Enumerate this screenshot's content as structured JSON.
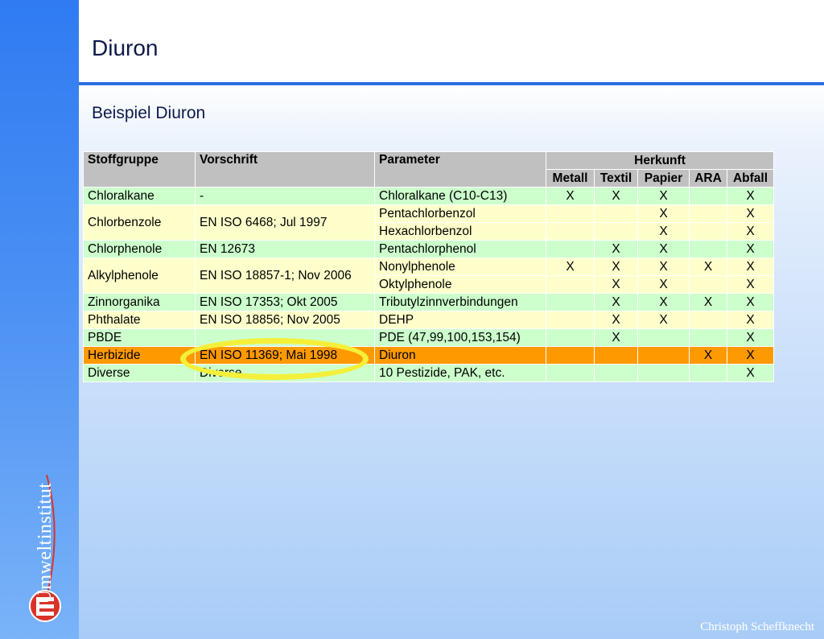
{
  "slide": {
    "title": "Diuron",
    "subtitle": "Beispiel Diuron",
    "footer": "Christoph Scheffknecht",
    "logo_text": "Umweltinstitut"
  },
  "table": {
    "headers": {
      "stoffgruppe": "Stoffgruppe",
      "vorschrift": "Vorschrift",
      "parameter": "Parameter",
      "herkunft": "Herkunft",
      "metall": "Metall",
      "textil": "Textil",
      "papier": "Papier",
      "ara": "ARA",
      "abfall": "Abfall"
    },
    "rows": [
      {
        "stoffgruppe": "Chloralkane",
        "vorschrift": "-",
        "parameter": "Chloralkane (C10-C13)",
        "metall": "X",
        "textil": "X",
        "papier": "X",
        "ara": "",
        "abfall": "X"
      },
      {
        "stoffgruppe": "Chlorbenzole",
        "vorschrift": "EN ISO 6468; Jul 1997",
        "parameter": "Pentachlorbenzol",
        "metall": "",
        "textil": "",
        "papier": "X",
        "ara": "",
        "abfall": "X"
      },
      {
        "parameter": "Hexachlorbenzol",
        "metall": "",
        "textil": "",
        "papier": "X",
        "ara": "",
        "abfall": "X"
      },
      {
        "stoffgruppe": "Chlorphenole",
        "vorschrift": "EN 12673",
        "parameter": "Pentachlorphenol",
        "metall": "",
        "textil": "X",
        "papier": "X",
        "ara": "",
        "abfall": "X"
      },
      {
        "stoffgruppe": "Alkylphenole",
        "vorschrift": "EN ISO 18857-1; Nov 2006",
        "parameter": "Nonylphenole",
        "metall": "X",
        "textil": "X",
        "papier": "X",
        "ara": "X",
        "abfall": "X"
      },
      {
        "parameter": "Oktylphenole",
        "metall": "",
        "textil": "X",
        "papier": "X",
        "ara": "",
        "abfall": "X"
      },
      {
        "stoffgruppe": "Zinnorganika",
        "vorschrift": "EN ISO 17353; Okt 2005",
        "parameter": "Tributylzinnverbindungen",
        "metall": "",
        "textil": "X",
        "papier": "X",
        "ara": "X",
        "abfall": "X"
      },
      {
        "stoffgruppe": "Phthalate",
        "vorschrift": "EN ISO 18856; Nov 2005",
        "parameter": "DEHP",
        "metall": "",
        "textil": "X",
        "papier": "X",
        "ara": "",
        "abfall": "X"
      },
      {
        "stoffgruppe": "PBDE",
        "vorschrift": "",
        "parameter": "PDE (47,99,100,153,154)",
        "metall": "",
        "textil": "X",
        "papier": "",
        "ara": "",
        "abfall": "X"
      },
      {
        "stoffgruppe": "Herbizide",
        "vorschrift": "EN ISO 11369; Mai 1998",
        "parameter": "Diuron",
        "metall": "",
        "textil": "",
        "papier": "",
        "ara": "X",
        "abfall": "X"
      },
      {
        "stoffgruppe": "Diverse",
        "vorschrift": "Diverse",
        "parameter": "10 Pestizide, PAK, etc.",
        "metall": "",
        "textil": "",
        "papier": "",
        "ara": "",
        "abfall": "X"
      }
    ]
  },
  "colors": {
    "header_gray": "#c0c0c0",
    "row_green": "#ccffcc",
    "row_yellow": "#ffffcc",
    "row_highlight": "#ff9900",
    "ellipse": "#f4f03a",
    "accent_blue": "#2a6fe0"
  }
}
